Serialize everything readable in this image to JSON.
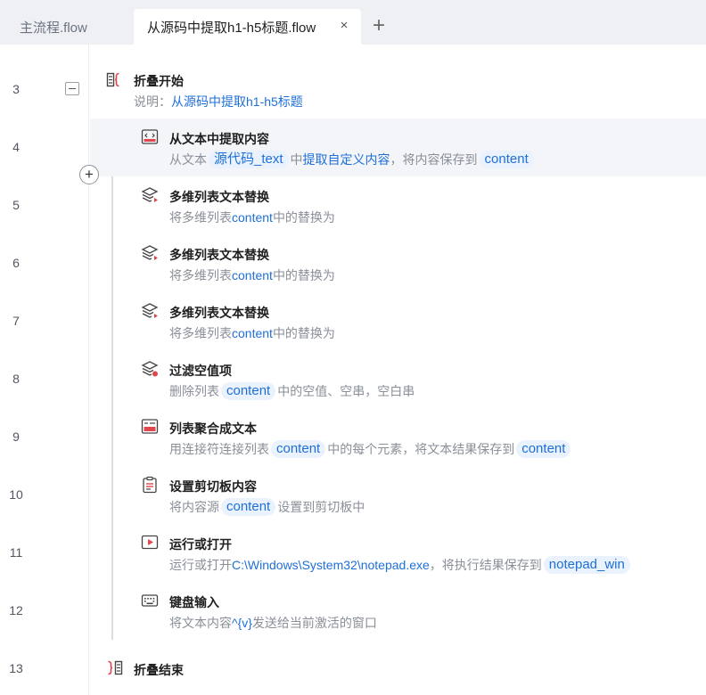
{
  "tabs": [
    {
      "label": "主流程.flow",
      "active": false
    },
    {
      "label": "从源码中提取h1-h5标题.flow",
      "active": true
    }
  ],
  "tab_close_symbol": "×",
  "tab_add_symbol": "+",
  "fold_start": {
    "line": "3",
    "title": "折叠开始",
    "note_label": "说明：",
    "note_value": "从源码中提取h1-h5标题"
  },
  "steps": [
    {
      "line": "4",
      "icon": "extract-text-icon",
      "title": "从文本中提取内容",
      "desc": {
        "p1": "从文本",
        "chip1": "源代码_text",
        "p2": "中",
        "v1": "提取自定义内容",
        "p3": "，将内容保存到",
        "chip2": "content"
      }
    },
    {
      "line": "5",
      "icon": "layers-replace-icon",
      "title": "多维列表文本替换",
      "desc": {
        "p1": "将多维列表",
        "v1": "content",
        "p2": "中的替换为"
      }
    },
    {
      "line": "6",
      "icon": "layers-replace-icon",
      "title": "多维列表文本替换",
      "desc": {
        "p1": "将多维列表",
        "v1": "content",
        "p2": "中的替换为"
      }
    },
    {
      "line": "7",
      "icon": "layers-replace-icon",
      "title": "多维列表文本替换",
      "desc": {
        "p1": "将多维列表",
        "v1": "content",
        "p2": "中的替换为"
      }
    },
    {
      "line": "8",
      "icon": "layers-filter-icon",
      "title": "过滤空值项",
      "desc": {
        "p1": "删除列表",
        "chip1": "content",
        "p2": "中的空值、空串，空白串"
      }
    },
    {
      "line": "9",
      "icon": "list-join-icon",
      "title": "列表聚合成文本",
      "desc": {
        "p1": "用连接符连接列表",
        "chip1": "content",
        "p2": "中的每个元素，将文本结果保存到",
        "chip2": "content"
      }
    },
    {
      "line": "10",
      "icon": "clipboard-icon",
      "title": "设置剪切板内容",
      "desc": {
        "p1": "将内容源",
        "chip1": "content",
        "p2": "设置到剪切板中"
      }
    },
    {
      "line": "11",
      "icon": "run-open-icon",
      "title": "运行或打开",
      "desc": {
        "p1": "运行或打开",
        "v1": "C:\\Windows\\System32\\notepad.exe",
        "p2": "，将执行结果保存到",
        "chip1": "notepad_win"
      }
    },
    {
      "line": "12",
      "icon": "keyboard-icon",
      "title": "键盘输入",
      "desc": {
        "p1": "将文本内容",
        "v1": "^{v}",
        "p2": "发送给当前激活的窗口"
      }
    }
  ],
  "fold_end": {
    "line": "13",
    "title": "折叠结束"
  },
  "colors": {
    "accent": "#1e6fd9",
    "chip_bg": "#eaf2fd",
    "fold_red": "#e0474c",
    "icon_red": "#e0474c"
  }
}
